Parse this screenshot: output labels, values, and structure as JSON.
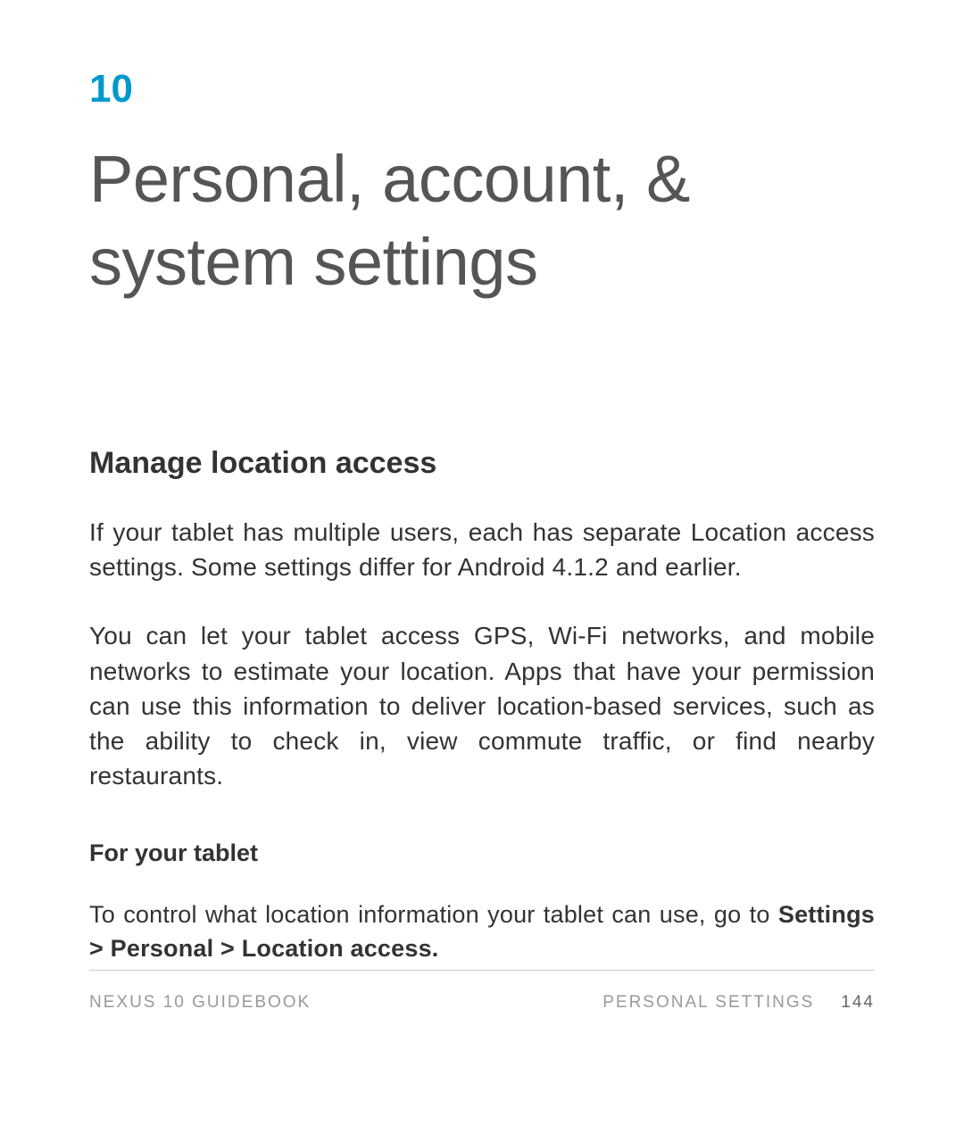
{
  "chapter": {
    "number": "10",
    "title": "Personal, account, & system settings"
  },
  "sections": {
    "heading1": "Manage location access",
    "paragraph1": "If your tablet has multiple users, each has separate Location access settings. Some settings differ for Android 4.1.2 and earlier.",
    "paragraph2": "You can let your tablet access GPS, Wi-Fi networks, and mobile networks to estimate your location. Apps that have your permission can use this information to deliver location-based services, such as the ability to check in, view commute traffic, or find nearby restaurants.",
    "subheading1": "For your tablet",
    "paragraph3_prefix": "To control what location information your tablet can use, go to ",
    "paragraph3_bold": "Settings > Personal > Location access."
  },
  "footer": {
    "book_title": "NEXUS 10 GUIDEBOOK",
    "section_name": "PERSONAL SETTINGS",
    "page_number": "144"
  }
}
